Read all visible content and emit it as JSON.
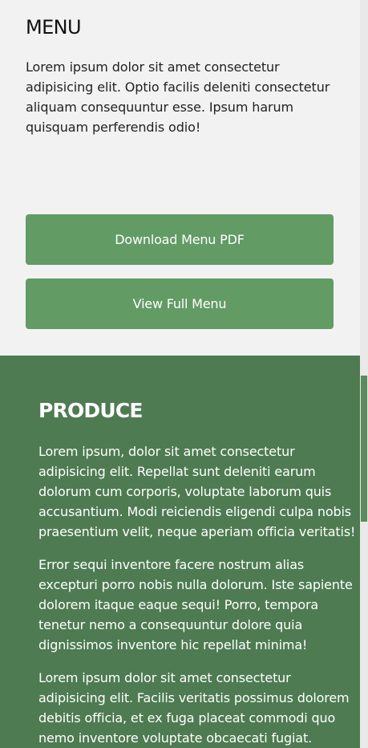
{
  "menu": {
    "title": "MENU",
    "description": "Lorem ipsum dolor sit amet consectetur adipisicing elit. Optio facilis deleniti consectetur aliquam consequuntur esse. Ipsum harum quisquam perferendis odio!",
    "buttons": {
      "download_label": "Download Menu PDF",
      "view_label": "View Full Menu"
    }
  },
  "produce": {
    "title": "PRODUCE",
    "paragraphs": [
      "Lorem ipsum, dolor sit amet consectetur adipisicing elit. Repellat sunt deleniti earum dolorum cum corporis, voluptate laborum quis accusantium. Modi reiciendis eligendi culpa nobis praesentium velit, neque aperiam officia veritatis!",
      "Error sequi inventore facere nostrum alias excepturi porro nobis nulla dolorum. Iste sapiente dolorem itaque eaque sequi! Porro, tempora tenetur nemo a consequuntur dolore quia dignissimos inventore hic repellat minima!",
      "Lorem ipsum dolor sit amet consectetur adipisicing elit. Facilis veritatis possimus dolorem debitis officia, et ex fuga placeat commodi quo nemo inventore voluptate obcaecati fugiat."
    ]
  },
  "colors": {
    "page_background": "#f2f2f2",
    "button_green": "#629b63",
    "produce_background": "#4e7b51",
    "scrollbar_track": "#e9e9e9",
    "scrollbar_thumb": "#5b8a5c",
    "text_dark": "#111111",
    "text_light": "#ffffff"
  }
}
